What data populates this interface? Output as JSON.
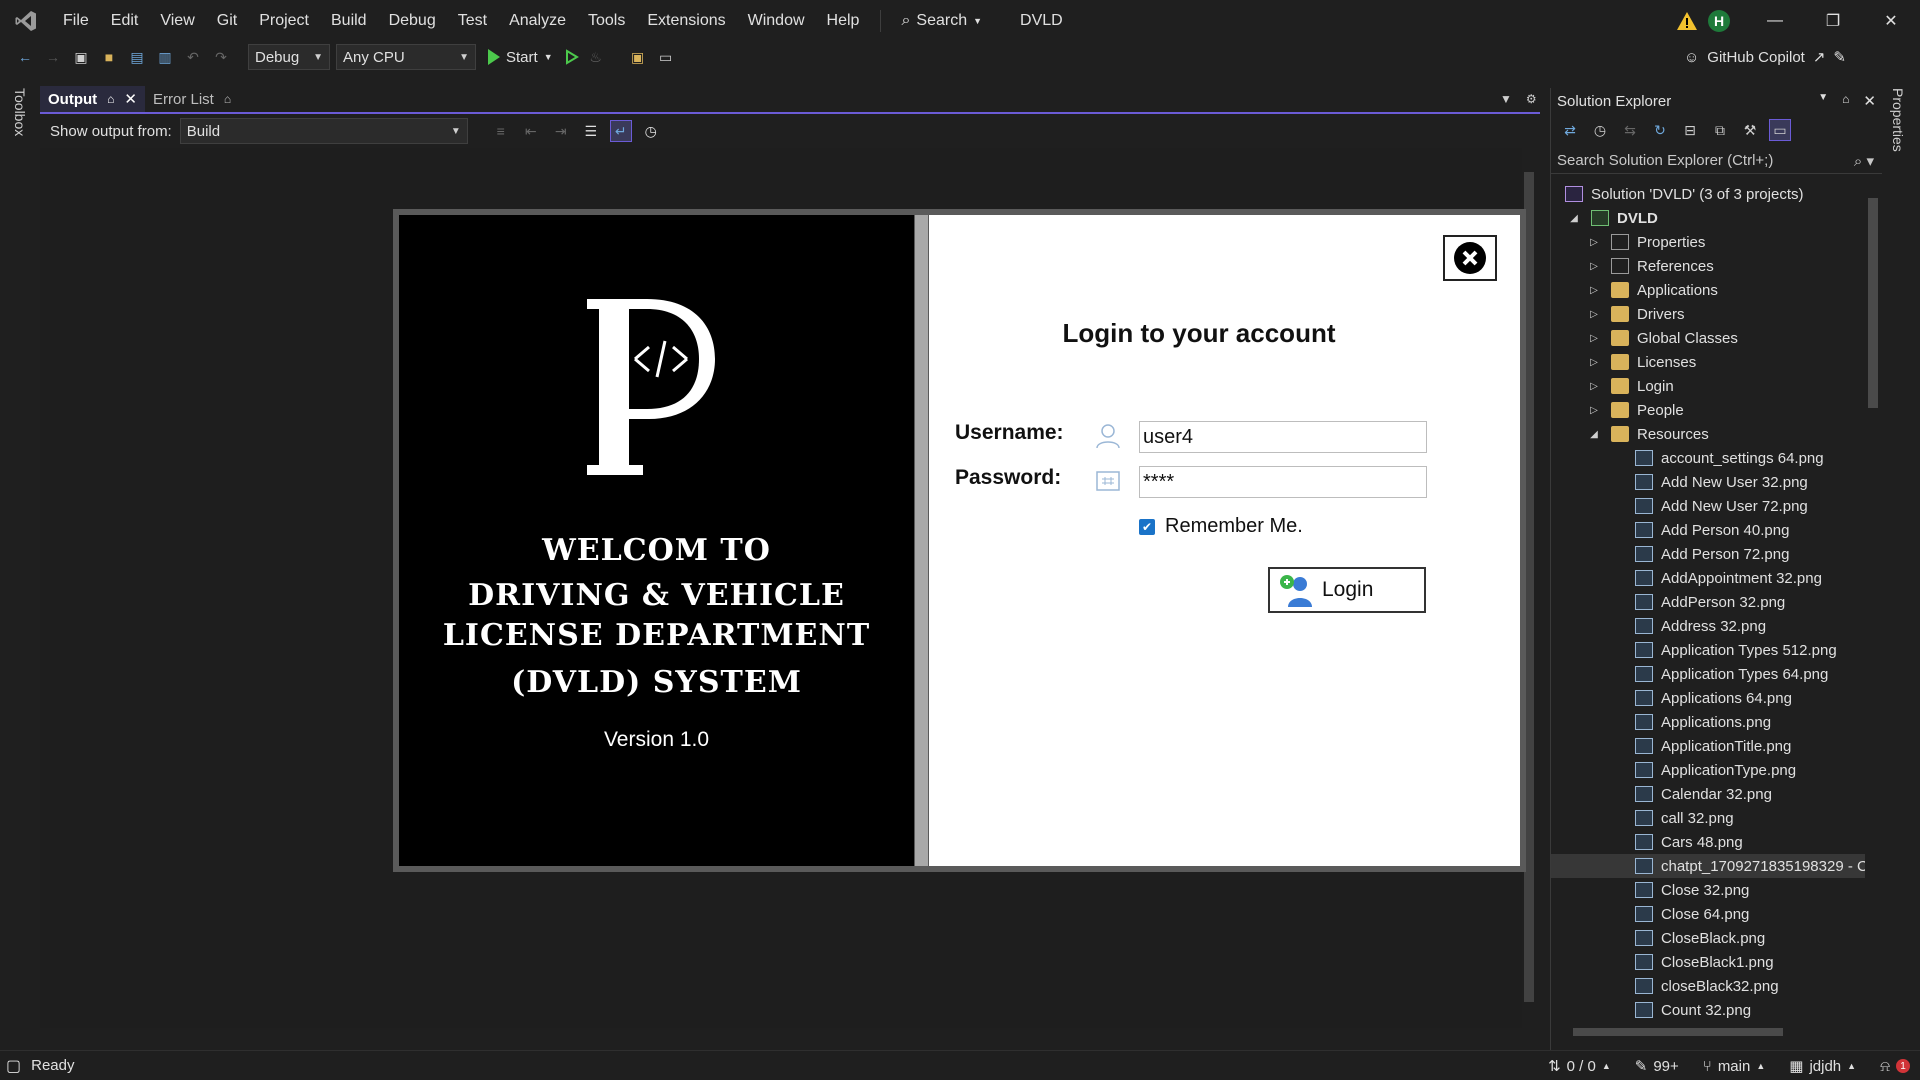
{
  "menubar": {
    "items": [
      "File",
      "Edit",
      "View",
      "Git",
      "Project",
      "Build",
      "Debug",
      "Test",
      "Analyze",
      "Tools",
      "Extensions",
      "Window",
      "Help"
    ],
    "search_label": "Search",
    "app_title": "DVLD",
    "user_initial": "H"
  },
  "toolbar": {
    "configuration": "Debug",
    "platform": "Any CPU",
    "start_label": "Start",
    "copilot_label": "GitHub Copilot"
  },
  "toolbox_label": "Toolbox",
  "properties_label": "Properties",
  "output_panel": {
    "tabs": [
      {
        "label": "Output",
        "active": true
      },
      {
        "label": "Error List",
        "active": false
      }
    ],
    "show_output_label": "Show output from:",
    "show_output_value": "Build"
  },
  "login_app": {
    "welcome_lines": [
      "WELCOM TO",
      "DRIVING & VEHICLE",
      "LICENSE DEPARTMENT",
      "(DVLD) SYSTEM"
    ],
    "version": "Version 1.0",
    "title": "Login to your account",
    "username_label": "Username:",
    "username_value": "user4",
    "password_label": "Password:",
    "password_value": "****",
    "remember_label": "Remember Me.",
    "remember_checked": true,
    "login_button": "Login"
  },
  "solution_explorer": {
    "title": "Solution Explorer",
    "search_placeholder": "Search Solution Explorer (Ctrl+;)",
    "solution_label": "Solution 'DVLD' (3 of 3 projects)",
    "project_label": "DVLD",
    "folders": [
      "Properties",
      "References",
      "Applications",
      "Drivers",
      "Global Classes",
      "Licenses",
      "Login",
      "People",
      "Resources"
    ],
    "resources": [
      "account_settings 64.png",
      "Add New User 32.png",
      "Add New User 72.png",
      "Add Person 40.png",
      "Add Person 72.png",
      "AddAppointment 32.png",
      "AddPerson 32.png",
      "Address 32.png",
      "Application Types 512.png",
      "Application Types 64.png",
      "Applications 64.png",
      "Applications.png",
      "ApplicationTitle.png",
      "ApplicationType.png",
      "Calendar 32.png",
      "call 32.png",
      "Cars 48.png",
      "chatpt_1709271835198329 - C",
      "Close 32.png",
      "Close 64.png",
      "CloseBlack.png",
      "CloseBlack1.png",
      "closeBlack32.png",
      "Count 32.png"
    ],
    "selected_index": 17
  },
  "statusbar": {
    "status": "Ready",
    "line_col": "0 / 0",
    "changes": "99+",
    "branch": "main",
    "repo": "jdjdh",
    "notifications": "1"
  },
  "colors": {
    "accent": "#6b5bd6",
    "background": "#1f1f1f",
    "start_green": "#4cc94c",
    "folder": "#d9b35b"
  }
}
